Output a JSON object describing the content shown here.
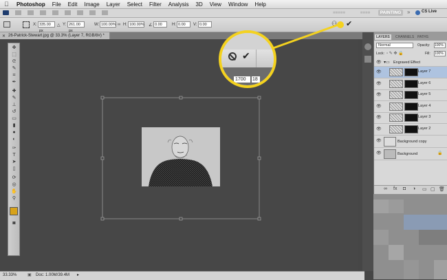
{
  "menubar": {
    "app_name": "Photoshop",
    "items": [
      "File",
      "Edit",
      "Image",
      "Layer",
      "Select",
      "Filter",
      "Analysis",
      "3D",
      "View",
      "Window",
      "Help"
    ]
  },
  "appbar": {
    "workspace_active": "PAINTING",
    "cs_live": "CS Live"
  },
  "options": {
    "x_label": "X:",
    "x_value": "335.00 px",
    "y_label": "Y:",
    "y_value": "261.00 px",
    "w_label": "W:",
    "w_value": "100.00%",
    "h_label": "H:",
    "h_value": "100.00%",
    "rot_value": "0.00",
    "hskew_label": "H:",
    "hskew_value": "0.00",
    "vskew_label": "V:",
    "vskew_value": "0.00",
    "commit_icon": "checkmark-icon",
    "cancel_icon": "cancel-icon"
  },
  "document": {
    "tab_title": "26-Patrick-Stewart.jpg @ 33.3% (Layer 7, RGB/8#) *"
  },
  "callout": {
    "ruler_a": "1700",
    "ruler_b": "18"
  },
  "status": {
    "zoom": "33.33%",
    "doc": "Doc: 1.00M/39.4M"
  },
  "layers_panel": {
    "tabs": [
      "LAYERS",
      "CHANNELS",
      "PATHS"
    ],
    "blend_mode": "Normal",
    "opacity_label": "Opacity:",
    "opacity_value": "100%",
    "lock_label": "Lock:",
    "fill_label": "Fill:",
    "fill_value": "100%",
    "group_name": "Engraved Effect",
    "layers": [
      {
        "name": "Layer 7",
        "selected": true
      },
      {
        "name": "Layer 6",
        "selected": false
      },
      {
        "name": "Layer 5",
        "selected": false
      },
      {
        "name": "Layer 4",
        "selected": false
      },
      {
        "name": "Layer 3",
        "selected": false
      },
      {
        "name": "Layer 2",
        "selected": false
      }
    ],
    "bg_copy": "Background copy",
    "bg": "Background"
  },
  "colors": {
    "accent": "#f4d21f",
    "selected_row": "#aec3e0"
  }
}
